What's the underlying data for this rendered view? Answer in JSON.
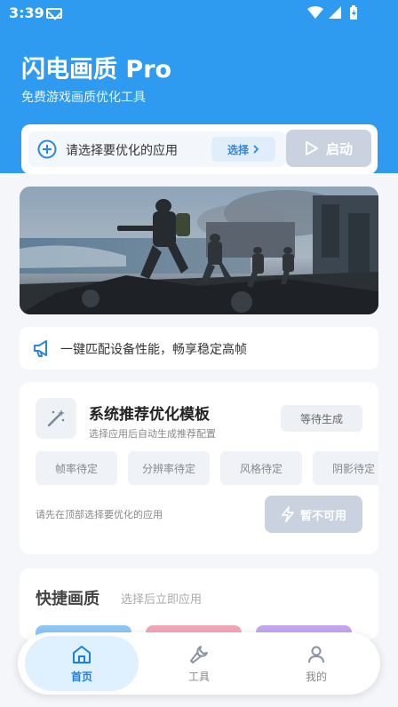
{
  "status_bar": {
    "time": "3:39"
  },
  "header": {
    "title": "闪电画质 Pro",
    "subtitle": "免费游戏画质优化工具"
  },
  "app_selector": {
    "prompt": "请选择要优化的应用",
    "choose_label": "选择",
    "start_label": "启动"
  },
  "notice": {
    "text": "一键匹配设备性能，畅享稳定高帧"
  },
  "template": {
    "title": "系统推荐优化模板",
    "subtitle": "选择应用后自动生成推荐配置",
    "status_button": "等待生成",
    "chips": [
      "帧率待定",
      "分辨率待定",
      "风格待定",
      "阴影待定"
    ],
    "hint": "请先在顶部选择要优化的应用",
    "action_label": "暂不可用"
  },
  "quick": {
    "title": "快捷画质",
    "subtitle": "选择后立即应用"
  },
  "bottom_nav": {
    "items": [
      {
        "label": "首页",
        "icon": "home-icon"
      },
      {
        "label": "工具",
        "icon": "wrench-icon"
      },
      {
        "label": "我的",
        "icon": "person-icon"
      }
    ]
  },
  "colors": {
    "primary": "#2e9bf0",
    "accent": "#1d7fe0",
    "disabled": "#c9d2de",
    "background": "#f4f6fa"
  }
}
